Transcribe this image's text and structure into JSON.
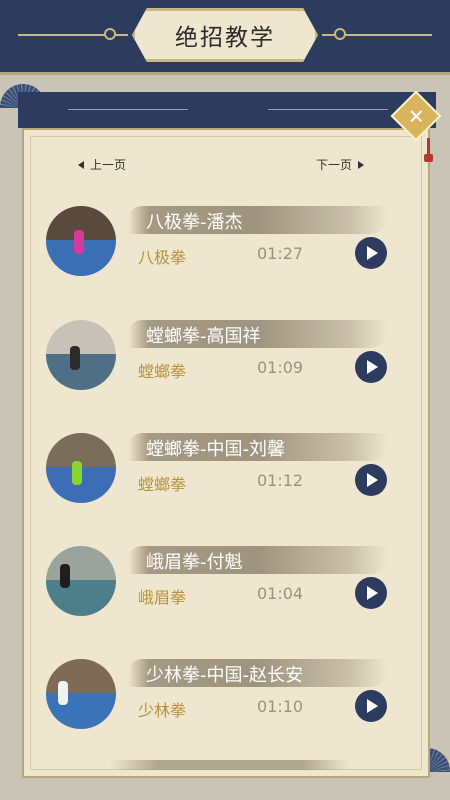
{
  "header": {
    "title": "绝招教学"
  },
  "pager": {
    "prev_label": "上一页",
    "next_label": "下一页"
  },
  "close_icon": "close-x-icon",
  "videos": [
    {
      "title": "八极拳-潘杰",
      "category": "八极拳",
      "duration": "01:27",
      "figure_color": "#d63b9c",
      "hall_color": "#5a4a3e",
      "floor_color": "#3a6fb5"
    },
    {
      "title": "螳螂拳-高国祥",
      "category": "螳螂拳",
      "duration": "01:09",
      "figure_color": "#2b2b2b",
      "hall_color": "#c7c2b8",
      "floor_color": "#4e6f86"
    },
    {
      "title": "螳螂拳-中国-刘馨",
      "category": "螳螂拳",
      "duration": "01:12",
      "figure_color": "#8ad62e",
      "hall_color": "#7a6d5a",
      "floor_color": "#3d6db5"
    },
    {
      "title": "峨眉拳-付魁",
      "category": "峨眉拳",
      "duration": "01:04",
      "figure_color": "#1f1f1f",
      "hall_color": "#9aa39c",
      "floor_color": "#4d7f8a"
    },
    {
      "title": "少林拳-中国-赵长安",
      "category": "少林拳",
      "duration": "01:10",
      "figure_color": "#f2f2f2",
      "hall_color": "#7e6a55",
      "floor_color": "#3b73b8"
    }
  ],
  "colors": {
    "navy": "#2c3b5e",
    "gold": "#b8923a",
    "paper": "#efe6cf"
  }
}
